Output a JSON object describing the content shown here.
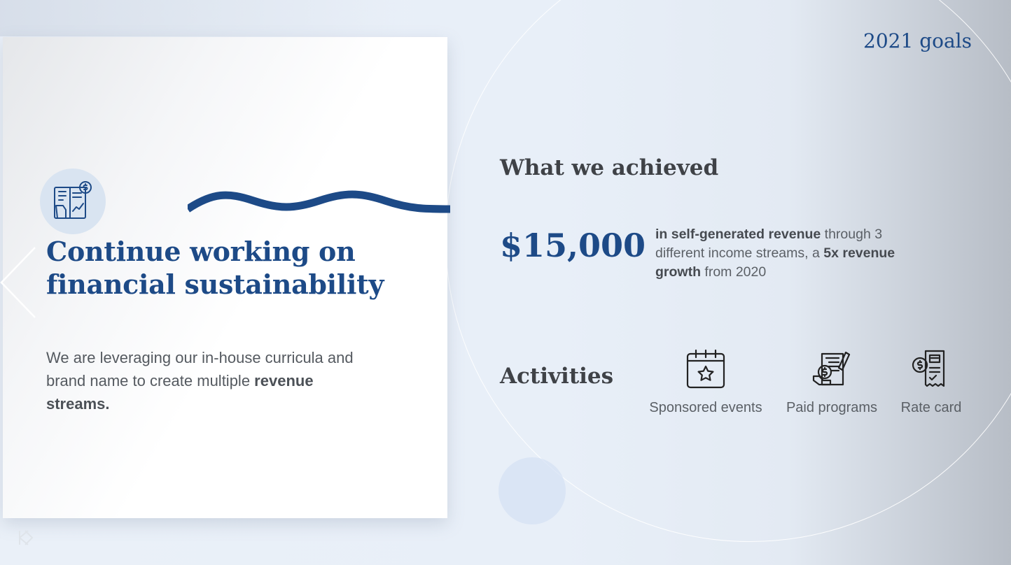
{
  "slide": {
    "corner_title": "2021 goals"
  },
  "card": {
    "title": "Continue working on financial sustainability",
    "body_prefix": "We are leveraging our in-house curricula and brand name to create multiple ",
    "body_bold": "revenue streams.",
    "icon": "financial-report-icon"
  },
  "achieved": {
    "heading": "What we achieved",
    "amount": "$15,000",
    "desc_bold_1": "in self-generated revenue",
    "desc_text_1": " through 3 different income streams, a ",
    "desc_bold_2": "5x revenue growth",
    "desc_text_2": " from 2020"
  },
  "activities": {
    "heading": "Activities",
    "items": [
      {
        "label": "Sponsored events",
        "icon": "calendar-star-icon"
      },
      {
        "label": "Paid programs",
        "icon": "hand-coin-document-icon"
      },
      {
        "label": "Rate card",
        "icon": "receipt-coin-icon"
      }
    ]
  },
  "colors": {
    "primary": "#1d4a87",
    "heading": "#3f4247",
    "body": "#5b6066"
  }
}
